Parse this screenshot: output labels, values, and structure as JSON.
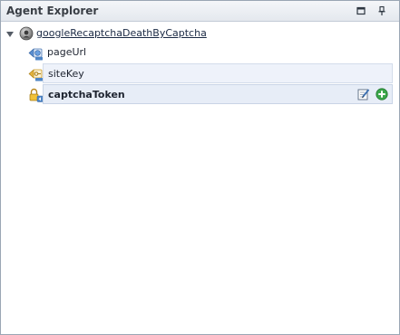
{
  "panel": {
    "title": "Agent Explorer",
    "controls": {
      "maximize_icon": "window-maximize-icon",
      "pin_icon": "pin-icon"
    }
  },
  "tree": {
    "agent": {
      "label": "googleRecaptchaDeathByCaptcha",
      "icon": "agent-icon",
      "expanded": true
    },
    "parameters": [
      {
        "label": "pageUrl",
        "icon": "url-input-parameter-icon",
        "selected": false
      },
      {
        "label": "siteKey",
        "icon": "key-input-parameter-icon",
        "selected": false
      },
      {
        "label": "captchaToken",
        "icon": "lock-output-parameter-icon",
        "selected": true
      }
    ],
    "row_actions": {
      "edit_icon": "edit-icon",
      "add_icon": "add-icon"
    }
  },
  "colors": {
    "title_bar": "#e8ecf1",
    "selected_row": "#e7edf7",
    "hover_row": "#eef2fa",
    "add_accent": "#2e9a3e",
    "border": "#9aa6b4"
  }
}
